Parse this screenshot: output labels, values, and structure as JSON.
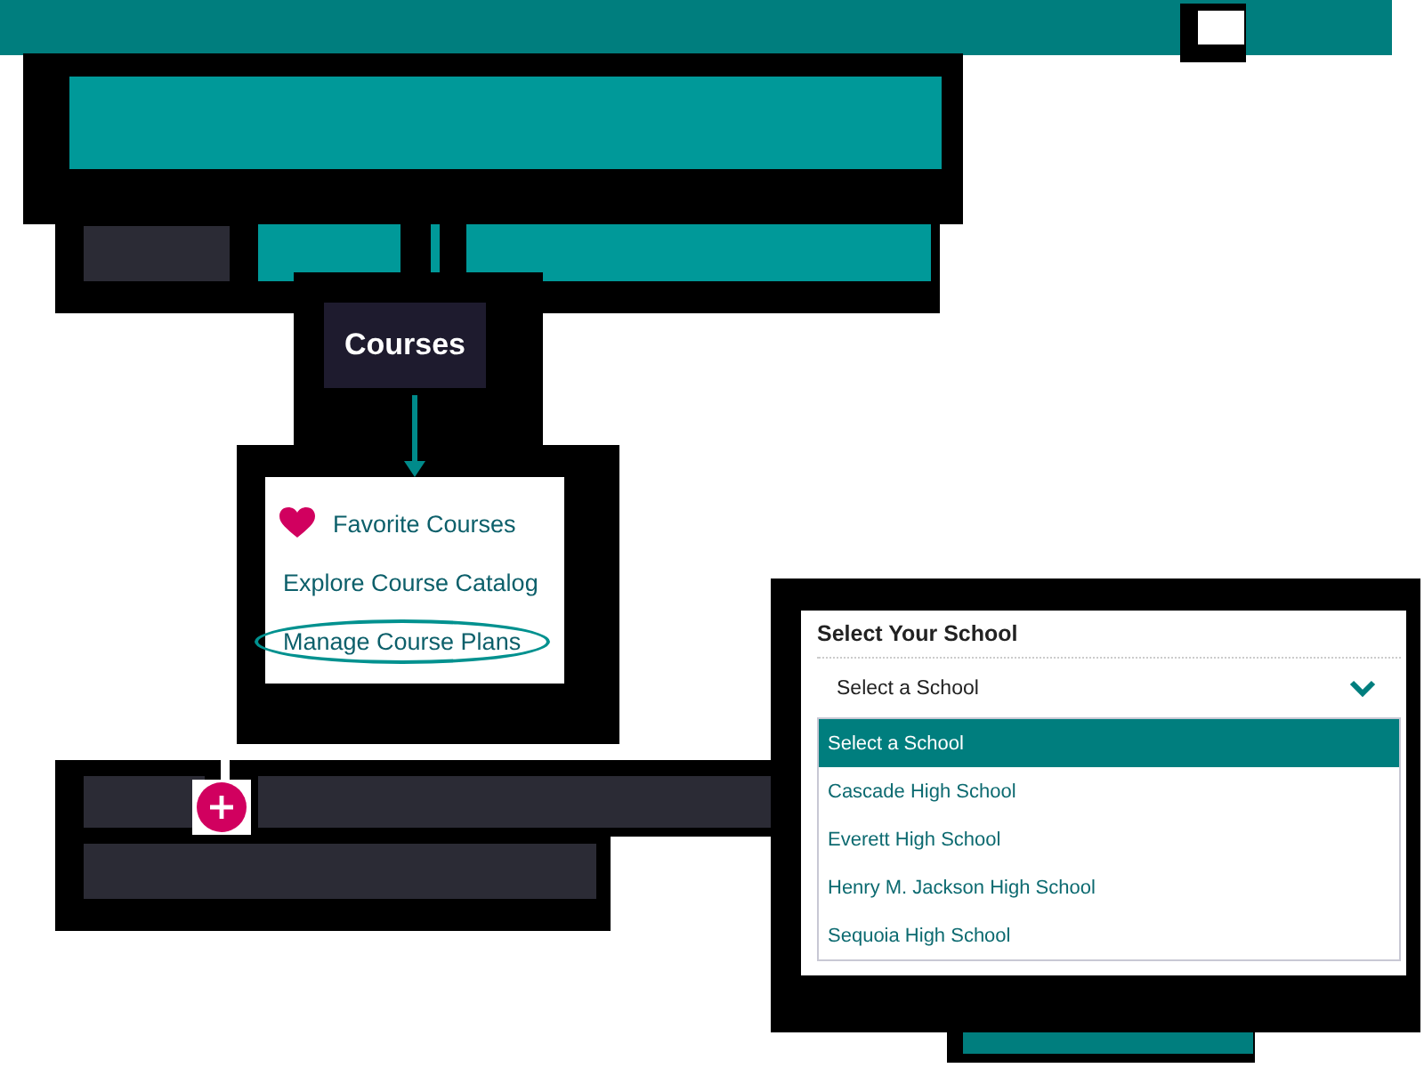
{
  "courses_menu": {
    "title": "Courses",
    "items": [
      {
        "label": "Favorite Courses",
        "kind": "favorite",
        "highlighted": false
      },
      {
        "label": "Explore Course Catalog",
        "kind": "link",
        "highlighted": false
      },
      {
        "label": "Manage Course Plans",
        "kind": "link",
        "highlighted": true
      }
    ]
  },
  "school_select": {
    "label": "Select Your School",
    "value": "Select a School",
    "options": [
      {
        "label": "Select a School",
        "selected": true
      },
      {
        "label": "Cascade High School",
        "selected": false
      },
      {
        "label": "Everett High School",
        "selected": false
      },
      {
        "label": "Henry M. Jackson High School",
        "selected": false
      },
      {
        "label": "Sequoia High School",
        "selected": false
      }
    ]
  }
}
